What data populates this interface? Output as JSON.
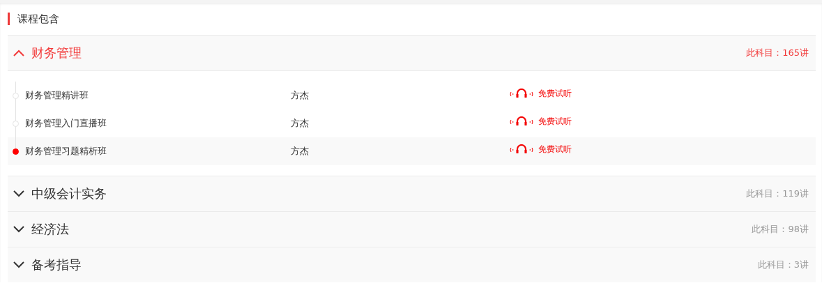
{
  "heading": "课程包含",
  "subjects": [
    {
      "name": "财务管理",
      "count": "此科目：165讲",
      "expanded": true,
      "courses": [
        {
          "name": "财务管理精讲班",
          "teacher": "方杰",
          "trial": "免费试听",
          "selected": false
        },
        {
          "name": "财务管理入门直播班",
          "teacher": "方杰",
          "trial": "免费试听",
          "selected": false
        },
        {
          "name": "财务管理习题精析班",
          "teacher": "方杰",
          "trial": "免费试听",
          "selected": true
        }
      ]
    },
    {
      "name": "中级会计实务",
      "count": "此科目：119讲",
      "expanded": false
    },
    {
      "name": "经济法",
      "count": "此科目：98讲",
      "expanded": false
    },
    {
      "name": "备考指导",
      "count": "此科目：3讲",
      "expanded": false
    }
  ]
}
